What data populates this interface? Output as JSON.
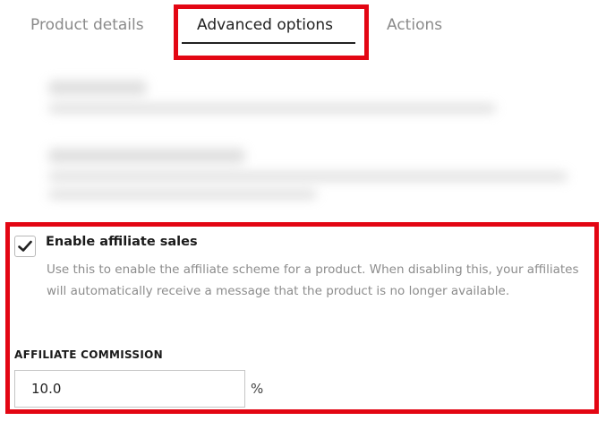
{
  "tabs": {
    "product_details": "Product details",
    "advanced_options": "Advanced options",
    "actions": "Actions"
  },
  "affiliate": {
    "enabled": true,
    "enable_label": "Enable affiliate sales",
    "help_text": "Use this to enable the affiliate scheme for a product. When disabling this, your affiliates will automatically receive a message that the product is no longer available.",
    "commission_label": "AFFILIATE COMMISSION",
    "commission_value": "10.0",
    "commission_unit": "%"
  },
  "colors": {
    "highlight": "#e30613",
    "text_muted": "#8c8c8c"
  }
}
